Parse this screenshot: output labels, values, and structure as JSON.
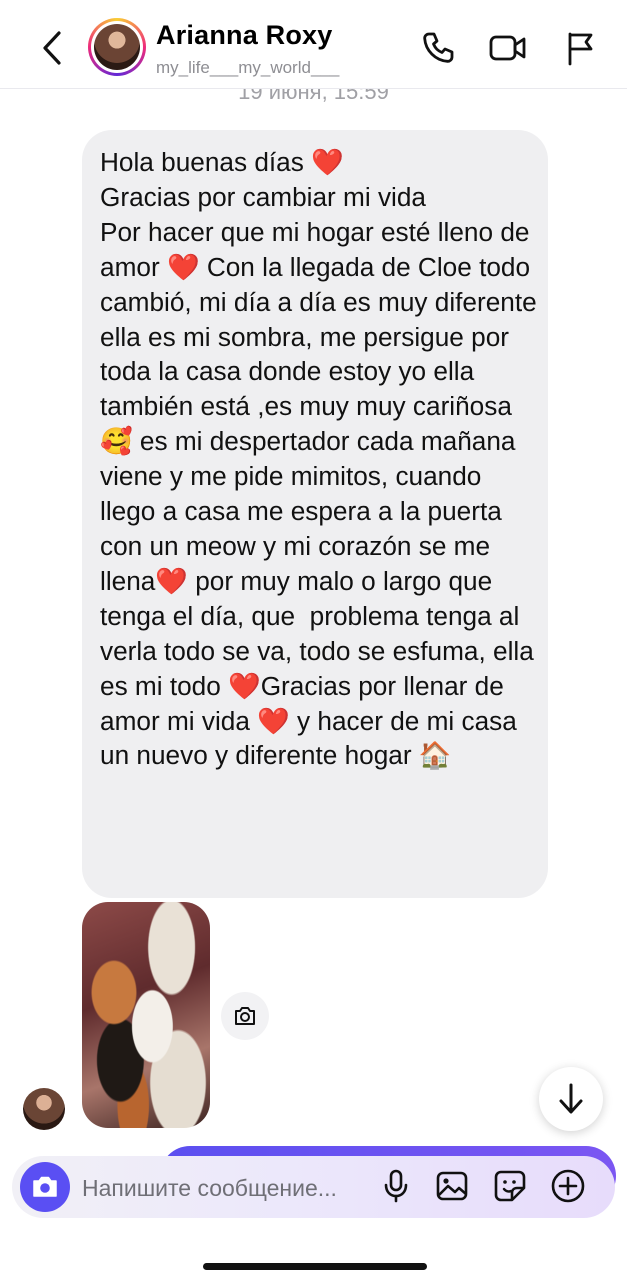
{
  "header": {
    "name": "Arianna Roxy",
    "username": "my_life___my_world___",
    "icons": [
      "back-chevron-icon",
      "phone-icon",
      "video-camera-icon",
      "flag-icon"
    ]
  },
  "conversation": {
    "date_separator": "19 июня, 15:59",
    "message_text": "Hola buenas días ❤️\nGracias por cambiar mi vida\nPor hacer que mi hogar esté lleno de amor ❤️ Con la llegada de Cloe todo cambió, mi día a día es muy diferente ella es mi sombra, me persigue por toda la casa donde estoy yo ella también está ,es muy muy cariñosa 🥰 es mi despertador cada mañana viene y me pide mimitos, cuando llego a casa me espera a la puerta con un meow y mi corazón se me llena❤️ por muy malo o largo que tenga el día, que  problema tenga al verla todo se va, todo se esfuma, ella es mi todo ❤️Gracias por llenar de amor mi vida ❤️ y hacer de mi casa un nuevo y diferente hogar 🏠",
    "photo_icon": "camera-icon"
  },
  "composer": {
    "placeholder": "Напишите сообщение...",
    "icons": [
      "camera-icon",
      "microphone-icon",
      "gallery-icon",
      "sticker-icon",
      "plus-circle-icon"
    ]
  },
  "colors": {
    "accent": "#5a4ff3",
    "bubble": "#efeff1",
    "secondary_text": "#8e8e93"
  }
}
